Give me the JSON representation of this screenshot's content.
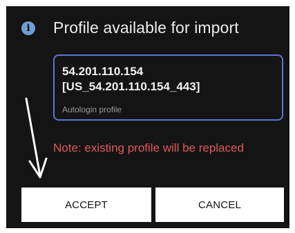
{
  "dialog": {
    "title": "Profile available for import",
    "icon": "info-icon",
    "profile": {
      "name": "54.201.110.154 [US_54.201.110.154_443]",
      "type": "Autologin profile"
    },
    "note": "Note: existing profile will be replaced",
    "buttons": {
      "accept": "ACCEPT",
      "cancel": "CANCEL"
    }
  },
  "colors": {
    "background": "#141414",
    "box_border": "#5e74d4",
    "note": "#e05a5a",
    "info_icon": "#6f9fd6"
  }
}
